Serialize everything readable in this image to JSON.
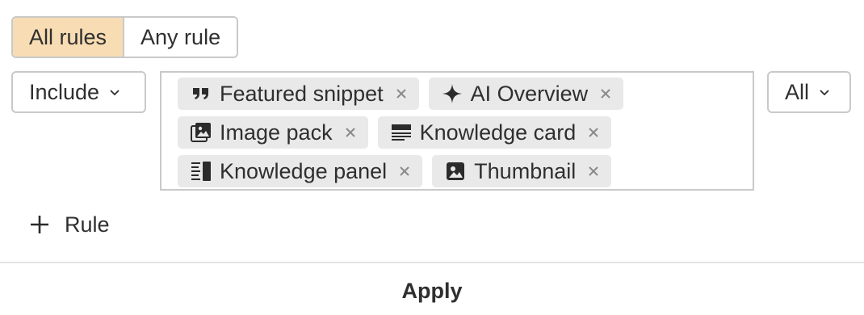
{
  "match_mode": {
    "options": [
      "All rules",
      "Any rule"
    ],
    "selected": "All rules"
  },
  "rule": {
    "operator": "Include",
    "scope": "All",
    "features": [
      {
        "label": "Featured snippet",
        "icon": "quote-icon"
      },
      {
        "label": "AI Overview",
        "icon": "sparkle-icon"
      },
      {
        "label": "Image pack",
        "icon": "image-pack-icon"
      },
      {
        "label": "Knowledge card",
        "icon": "knowledge-card-icon"
      },
      {
        "label": "Knowledge panel",
        "icon": "knowledge-panel-icon"
      },
      {
        "label": "Thumbnail",
        "icon": "thumbnail-icon"
      }
    ]
  },
  "add_rule_label": "Rule",
  "apply_label": "Apply",
  "colors": {
    "active_segment": "#f8dcb3",
    "chip_background": "#e9e9e9",
    "border": "#c9c9c9"
  }
}
